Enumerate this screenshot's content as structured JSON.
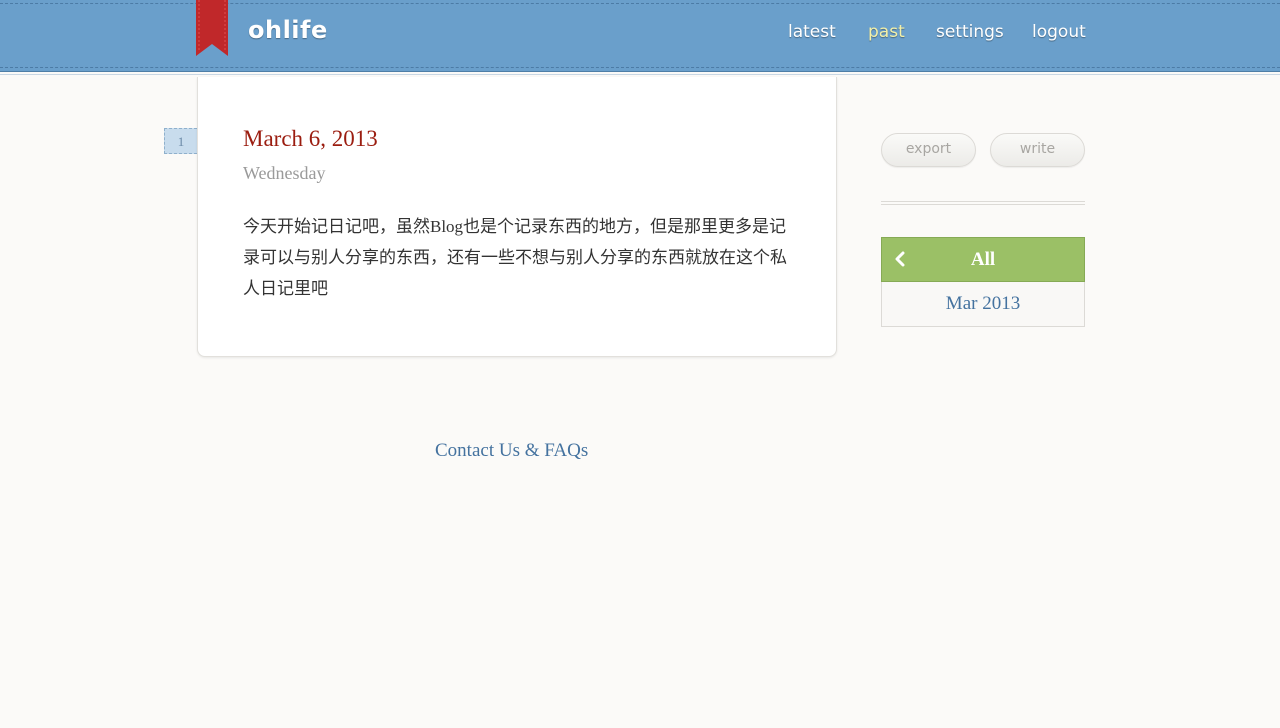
{
  "header": {
    "logo": "ohlife",
    "nav": [
      {
        "label": "latest",
        "active": false
      },
      {
        "label": "past",
        "active": true
      },
      {
        "label": "settings",
        "active": false
      },
      {
        "label": "logout",
        "active": false
      }
    ]
  },
  "entry": {
    "count": "1",
    "date": "March 6, 2013",
    "weekday": "Wednesday",
    "body": "今天开始记日记吧，虽然Blog也是个记录东西的地方，但是那里更多是记录可以与别人分享的东西，还有一些不想与别人分享的东西就放在这个私人日记里吧"
  },
  "footer": {
    "contact": "Contact Us & FAQs"
  },
  "sidebar": {
    "export": "export",
    "write": "write",
    "all": "All",
    "months": [
      "Mar 2013"
    ]
  },
  "colors": {
    "header": "#6a9fcb",
    "bookmark": "#c0282a",
    "date": "#9b1d10",
    "link": "#44729f",
    "green": "#9bc066",
    "active_nav": "#f3f0a8"
  },
  "icons": {
    "bookmark": "bookmark-ribbon-icon",
    "back": "chevron-left-icon"
  }
}
